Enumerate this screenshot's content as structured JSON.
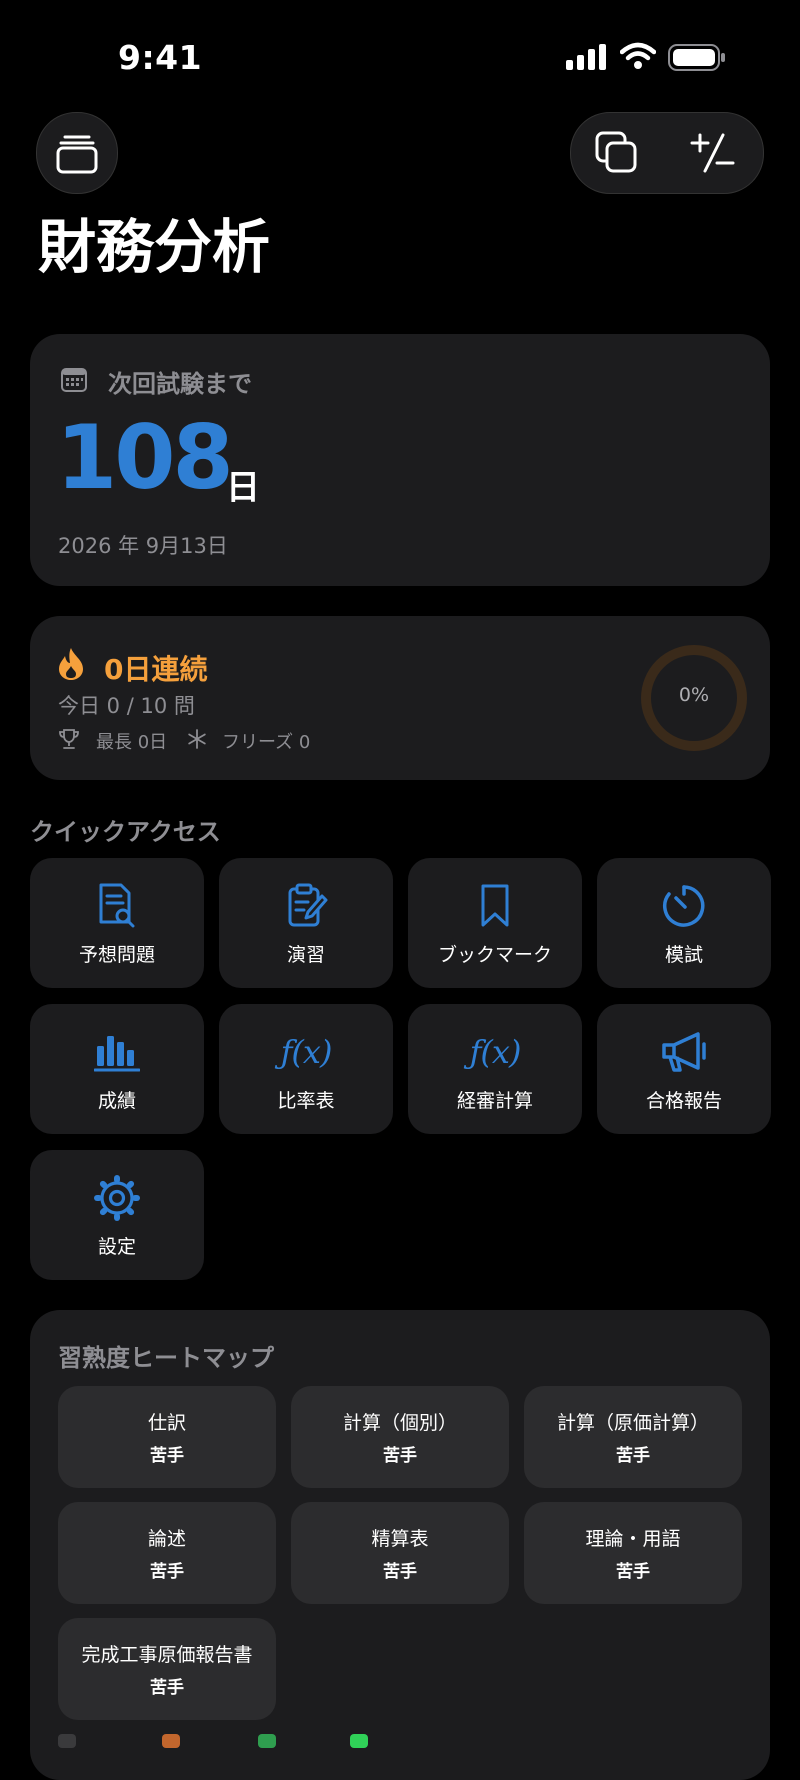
{
  "status_bar": {
    "time": "9:41"
  },
  "header": {
    "title": "財務分析"
  },
  "exam": {
    "label": "次回試験まで",
    "days": "108",
    "unit": "日",
    "date": "2026 年 9月13日"
  },
  "streak": {
    "title": "0日連続",
    "today": "今日 0 / 10 問",
    "best": "最長 0日",
    "freeze": "フリーズ 0",
    "progress_text": "0%",
    "progress": 0
  },
  "quick_access": {
    "heading": "クイックアクセス",
    "items": [
      {
        "label": "予想問題",
        "icon": "document-search-icon"
      },
      {
        "label": "演習",
        "icon": "clipboard-edit-icon"
      },
      {
        "label": "ブックマーク",
        "icon": "bookmark-icon"
      },
      {
        "label": "模試",
        "icon": "timer-icon"
      },
      {
        "label": "成績",
        "icon": "bar-chart-icon"
      },
      {
        "label": "比率表",
        "icon": "function-icon",
        "glyph": "ƒ(x)"
      },
      {
        "label": "経審計算",
        "icon": "function-icon",
        "glyph": "ƒ(x)"
      },
      {
        "label": "合格報告",
        "icon": "megaphone-icon"
      },
      {
        "label": "設定",
        "icon": "gear-icon"
      }
    ]
  },
  "heatmap": {
    "heading": "習熟度ヒートマップ",
    "cells": [
      {
        "topic": "仕訳",
        "level": "苦手"
      },
      {
        "topic": "計算（個別）",
        "level": "苦手"
      },
      {
        "topic": "計算（原価計算）",
        "level": "苦手"
      },
      {
        "topic": "論述",
        "level": "苦手"
      },
      {
        "topic": "精算表",
        "level": "苦手"
      },
      {
        "topic": "理論・用語",
        "level": "苦手"
      },
      {
        "topic": "完成工事原価報告書",
        "level": "苦手"
      }
    ]
  },
  "colors": {
    "accent": "#2f7fd4",
    "streak": "#f5a03c",
    "card": "#1c1c1e",
    "cell": "#2c2c2e"
  }
}
